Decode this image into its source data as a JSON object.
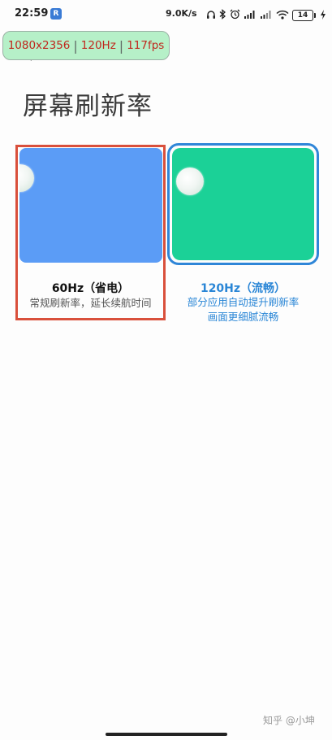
{
  "status_bar": {
    "time": "22:59",
    "app_icon_label": "R",
    "net_speed": "9.0K/s",
    "battery": "14",
    "icons": [
      "headphones-icon",
      "bluetooth-icon",
      "alarm-icon",
      "signal-icon",
      "signal-icon",
      "wifi-icon",
      "battery-icon",
      "charging-icon"
    ]
  },
  "fps_overlay": {
    "resolution": "1080x2356",
    "refresh_rate": "120Hz",
    "fps": "117fps"
  },
  "page": {
    "title": "屏幕刷新率"
  },
  "options": [
    {
      "name": "60Hz（省电）",
      "description": [
        "常规刷新率，延长续航时间"
      ],
      "selected": true,
      "preview_color": "#5b9cf6"
    },
    {
      "name": "120Hz（流畅）",
      "description": [
        "部分应用自动提升刷新率",
        "画面更细腻流畅"
      ],
      "selected": false,
      "preview_color": "#1bd197"
    }
  ],
  "watermark": "知乎 @小坤",
  "colors": {
    "selection_frame": "#d9503c",
    "accent_blue": "#2a86d6",
    "overlay_bg": "#b6f0c8",
    "overlay_text": "#c0271d"
  }
}
